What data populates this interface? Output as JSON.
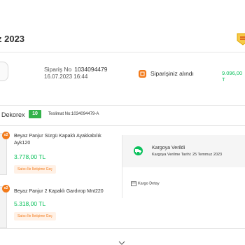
{
  "header": {
    "title": "z 2023",
    "seal_icon": "seal-icon"
  },
  "order": {
    "number_label": "Sipariş No",
    "number": "1034094479",
    "date": "16.07.2023 16:44",
    "status": "Siparişiniz alındı",
    "total": "9.096,00 T"
  },
  "seller": {
    "name": "Dekorex",
    "score": "10",
    "delivery_no": "Teslimat No:1034094479-A"
  },
  "items": [
    {
      "qty": "x2",
      "name": "Beyaz Panjur Sürgü Kapaklı Ayakkabılık Ayk120",
      "price": "3.778,00 TL",
      "ask_label": "Satıcı İle İletişime Geç"
    },
    {
      "qty": "x2",
      "name": "Beyaz Panjur 2 Kapaklı Gardırop Mnt220",
      "price": "5.318,00 TL",
      "ask_label": "Satıcı İle İletişime Geç"
    }
  ],
  "shipment": {
    "title": "Kargoya Verildi",
    "date": "Kargoya Verilme Tarihi: 25 Temmuz 2023",
    "detail_label": "Kargo Detay"
  },
  "colors": {
    "accent": "#f27a1a",
    "price": "#0bc15c",
    "score": "#33b24a"
  }
}
